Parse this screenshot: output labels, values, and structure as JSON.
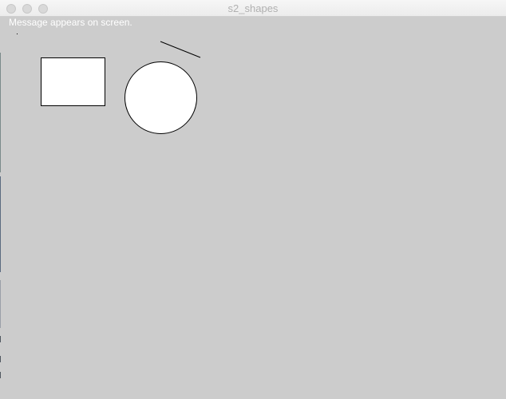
{
  "window": {
    "title": "s2_shapes"
  },
  "canvas": {
    "message": "Message appears on screen.",
    "background_color": "#cccccc",
    "shapes": [
      {
        "kind": "rectangle",
        "fill": "#ffffff",
        "stroke": "#000000"
      },
      {
        "kind": "circle",
        "fill": "#ffffff",
        "stroke": "#000000"
      },
      {
        "kind": "line",
        "stroke": "#000000"
      },
      {
        "kind": "point",
        "stroke": "#000000"
      }
    ]
  }
}
